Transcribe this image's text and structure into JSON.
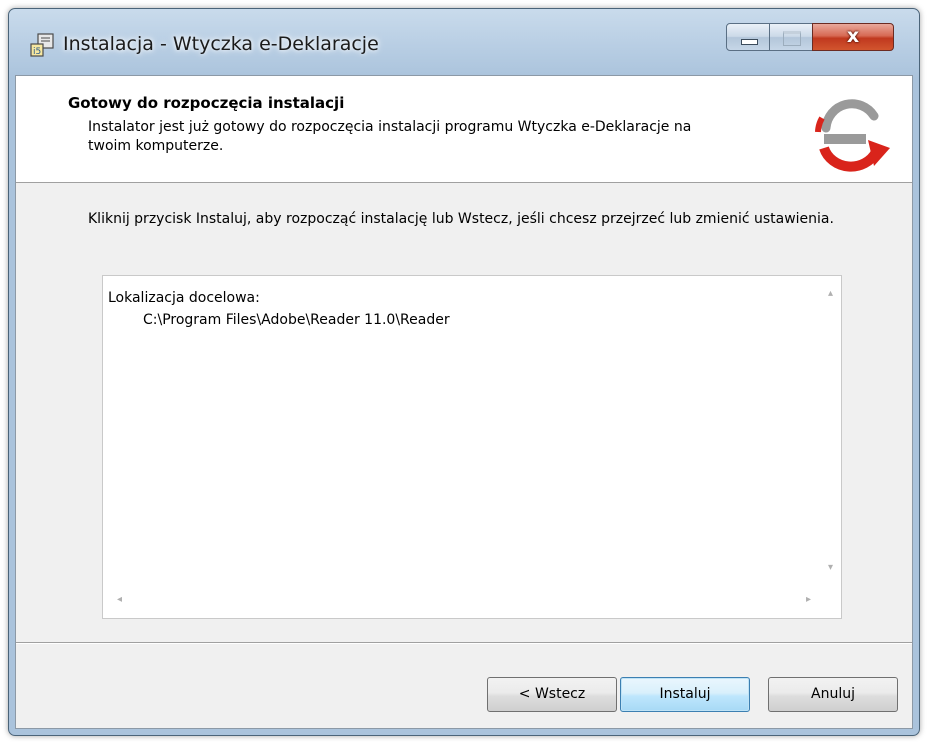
{
  "window": {
    "title": "Instalacja - Wtyczka e-Deklaracje",
    "close_glyph": "x"
  },
  "header": {
    "title": "Gotowy do rozpoczęcia instalacji",
    "description": "Instalator jest już gotowy do rozpoczęcia instalacji programu Wtyczka e-Deklaracje na twoim komputerze."
  },
  "main": {
    "instruction": "Kliknij przycisk Instaluj, aby rozpocząć instalację lub Wstecz, jeśli chcesz przejrzeć lub zmienić ustawienia.",
    "memo": {
      "label": "Lokalizacja docelowa:",
      "path": "C:\\Program Files\\Adobe\\Reader 11.0\\Reader"
    }
  },
  "buttons": {
    "back": "< Wstecz",
    "install": "Instaluj",
    "cancel": "Anuluj"
  },
  "colors": {
    "logo_red": "#d9241b",
    "logo_gray": "#9a9a9a",
    "default_button_border": "#3c7fb1"
  }
}
